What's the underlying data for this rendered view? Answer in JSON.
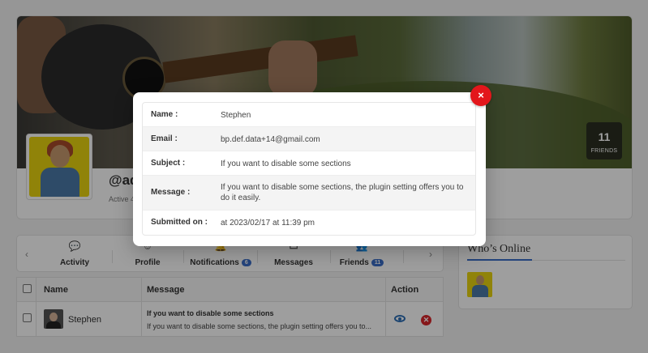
{
  "profile": {
    "username": "@ad",
    "active_text": "Active 4",
    "friends_count": "11",
    "friends_label": "FRIENDS"
  },
  "nav": {
    "prev_icon": "chevron-left-icon",
    "next_icon": "chevron-right-icon",
    "items": [
      {
        "label": "Activity",
        "icon": "chat-bubbles-icon"
      },
      {
        "label": "Profile",
        "icon": "user-icon"
      },
      {
        "label": "Notifications",
        "icon": "bell-icon",
        "badge": "6"
      },
      {
        "label": "Messages",
        "icon": "inbox-icon"
      },
      {
        "label": "Friends",
        "icon": "users-icon",
        "badge": "11"
      }
    ]
  },
  "table": {
    "headers": {
      "name": "Name",
      "message": "Message",
      "action": "Action"
    },
    "rows": [
      {
        "name": "Stephen",
        "subject": "If you want to disable some sections",
        "message": "If you want to disable some sections, the plugin setting offers you to..."
      }
    ]
  },
  "online": {
    "title": "Who’s Online"
  },
  "modal": {
    "close_label": "×",
    "fields": [
      {
        "label": "Name :",
        "value": "Stephen"
      },
      {
        "label": "Email :",
        "value": "bp.def.data+14@gmail.com"
      },
      {
        "label": "Subject :",
        "value": "If you want to disable some sections"
      },
      {
        "label": "Message :",
        "value": "If you want to disable some sections, the plugin setting offers you to do it easily."
      },
      {
        "label": "Submitted on :",
        "value": "at 2023/02/17 at 11:39 pm"
      }
    ]
  },
  "colors": {
    "accent": "#3a6fc9",
    "close": "#e3161b",
    "delete": "#d9262a",
    "view": "#2a6db5"
  }
}
